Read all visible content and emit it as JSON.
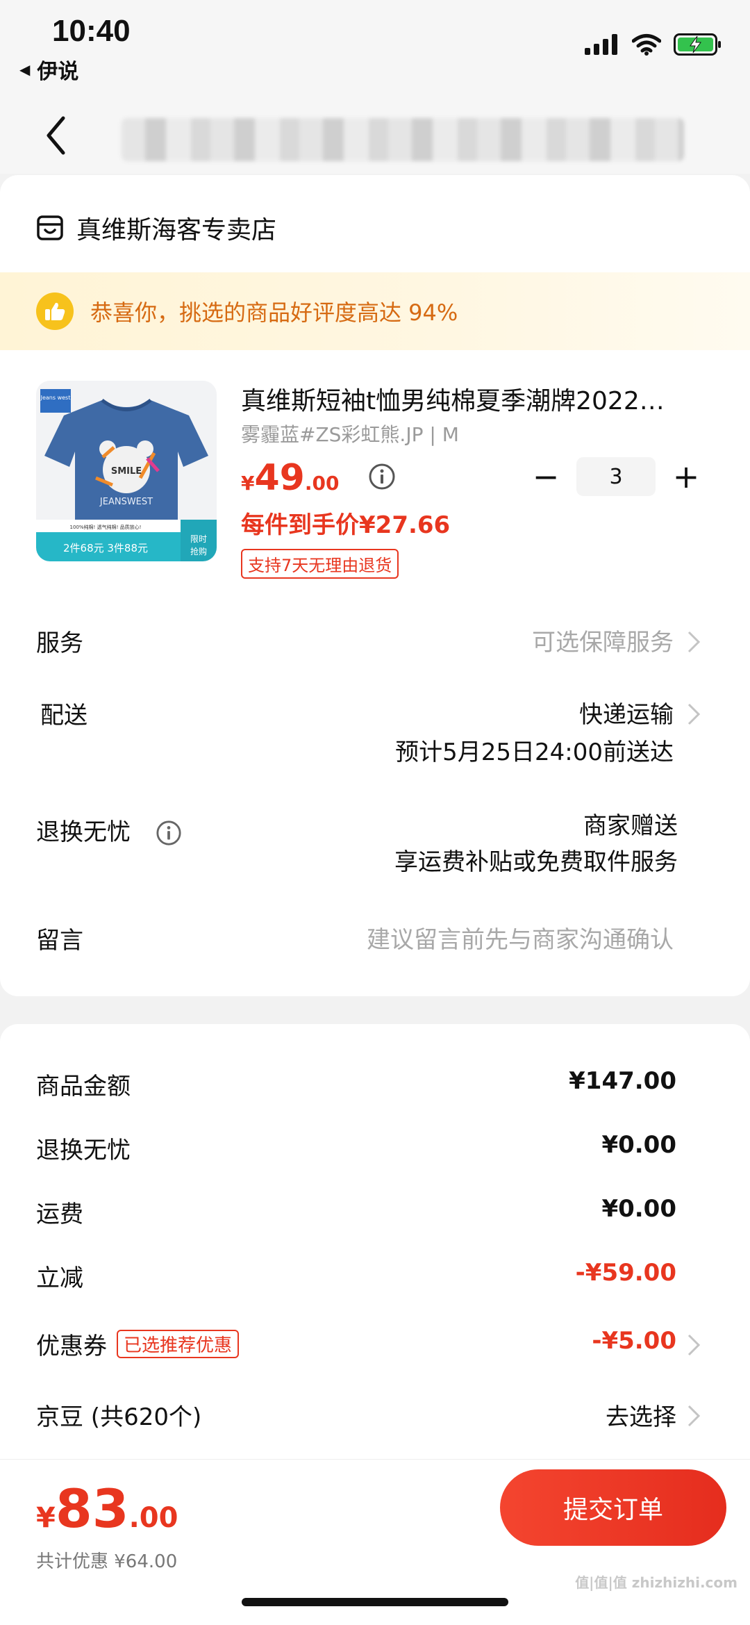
{
  "status_bar": {
    "time": "10:40",
    "back_app": "伊说",
    "icons": [
      "signal-icon",
      "wifi-icon",
      "battery-charging-icon"
    ]
  },
  "nav": {
    "back_icon": "chevron-left-icon"
  },
  "shop": {
    "icon": "store-icon",
    "name": "真维斯海客专卖店"
  },
  "banner": {
    "icon": "thumbs-up-icon",
    "text": "恭喜你，挑选的商品好评度高达 94%"
  },
  "product": {
    "title": "真维斯短袖t恤男纯棉夏季潮牌2022…",
    "spec": "雾霾蓝#ZS彩虹熊.JP | M",
    "price_currency": "¥",
    "price_int": "49",
    "price_dec": ".00",
    "unit_price": "每件到手价¥27.66",
    "return_badge": "支持7天无理由退货",
    "quantity": "3",
    "minus": "−",
    "plus": "+",
    "image": {
      "brand": "Jeans west",
      "graphic_word": "SMILE",
      "graphic_brand": "JEANSWEST",
      "strip_text": "100%纯棉! 透气纯棉! 品质放心!",
      "promo": "2件68元 3件88元",
      "limited": "限时抢购"
    }
  },
  "rows": {
    "service": {
      "label": "服务",
      "value": "可选保障服务"
    },
    "delivery": {
      "label": "配送",
      "value": "快递运输",
      "eta": "预计5月25日24:00前送达"
    },
    "worry_free": {
      "label": "退换无忧",
      "value": "商家赠送",
      "detail": "享运费补贴或免费取件服务"
    },
    "message": {
      "label": "留言",
      "placeholder": "建议留言前先与商家沟通确认"
    }
  },
  "summary": {
    "goods_amount": {
      "label": "商品金额",
      "value": "¥147.00"
    },
    "worry_free_fee": {
      "label": "退换无忧",
      "value": "¥0.00"
    },
    "shipping": {
      "label": "运费",
      "value": "¥0.00"
    },
    "discount": {
      "label": "立减",
      "value": "-¥59.00"
    },
    "coupon": {
      "label": "优惠券",
      "badge": "已选推荐优惠",
      "value": "-¥5.00"
    },
    "jd_beans": {
      "label": "京豆 (共620个)",
      "value": "去选择"
    }
  },
  "footer": {
    "total_currency": "¥",
    "total_int": "83",
    "total_dec": ".00",
    "saved": "共计优惠 ¥64.00",
    "submit": "提交订单"
  },
  "watermark": "值|值|值 zhizhizhi.com",
  "colors": {
    "accent_red": "#e8361f",
    "banner_text": "#d66a12",
    "banner_bg": "#fff4d6"
  }
}
